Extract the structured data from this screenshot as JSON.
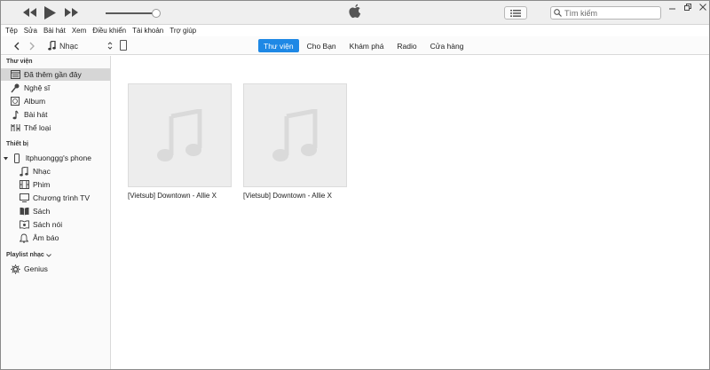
{
  "search": {
    "placeholder": "Tìm kiếm"
  },
  "menu": [
    "Tệp",
    "Sửa",
    "Bài hát",
    "Xem",
    "Điều khiển",
    "Tài khoản",
    "Trợ giúp"
  ],
  "nav": {
    "media_label": "Nhạc"
  },
  "tabs": [
    {
      "label": "Thư viện",
      "active": true
    },
    {
      "label": "Cho Bạn",
      "active": false
    },
    {
      "label": "Khám phá",
      "active": false
    },
    {
      "label": "Radio",
      "active": false
    },
    {
      "label": "Cửa hàng",
      "active": false
    }
  ],
  "player": {
    "volume_level": 0.95
  },
  "sidebar": {
    "library_title": "Thư viện",
    "library_items": [
      {
        "label": "Đã thêm gần đây",
        "icon": "recently-added-icon",
        "selected": true
      },
      {
        "label": "Nghệ sĩ",
        "icon": "microphone-icon"
      },
      {
        "label": "Album",
        "icon": "album-icon"
      },
      {
        "label": "Bài hát",
        "icon": "music-note-icon"
      },
      {
        "label": "Thể loại",
        "icon": "genre-icon"
      }
    ],
    "devices_title": "Thiết bị",
    "device_name": "ltphuonggg's phone",
    "device_items": [
      {
        "label": "Nhạc",
        "icon": "music-notes-icon"
      },
      {
        "label": "Phim",
        "icon": "film-icon"
      },
      {
        "label": "Chương trình TV",
        "icon": "tv-icon"
      },
      {
        "label": "Sách",
        "icon": "book-icon"
      },
      {
        "label": "Sách nói",
        "icon": "audiobook-icon"
      },
      {
        "label": "Âm báo",
        "icon": "bell-icon"
      }
    ],
    "playlists_title": "Playlist nhạc",
    "playlist_items": [
      {
        "label": "Genius",
        "icon": "genius-icon"
      }
    ]
  },
  "main": {
    "items": [
      {
        "title": "[Vietsub] Downtown - Allie X"
      },
      {
        "title": "[Vietsub] Downtown - Allie X"
      }
    ]
  },
  "colors": {
    "accent": "#1e88e5",
    "selection": "#d6d6d6"
  }
}
